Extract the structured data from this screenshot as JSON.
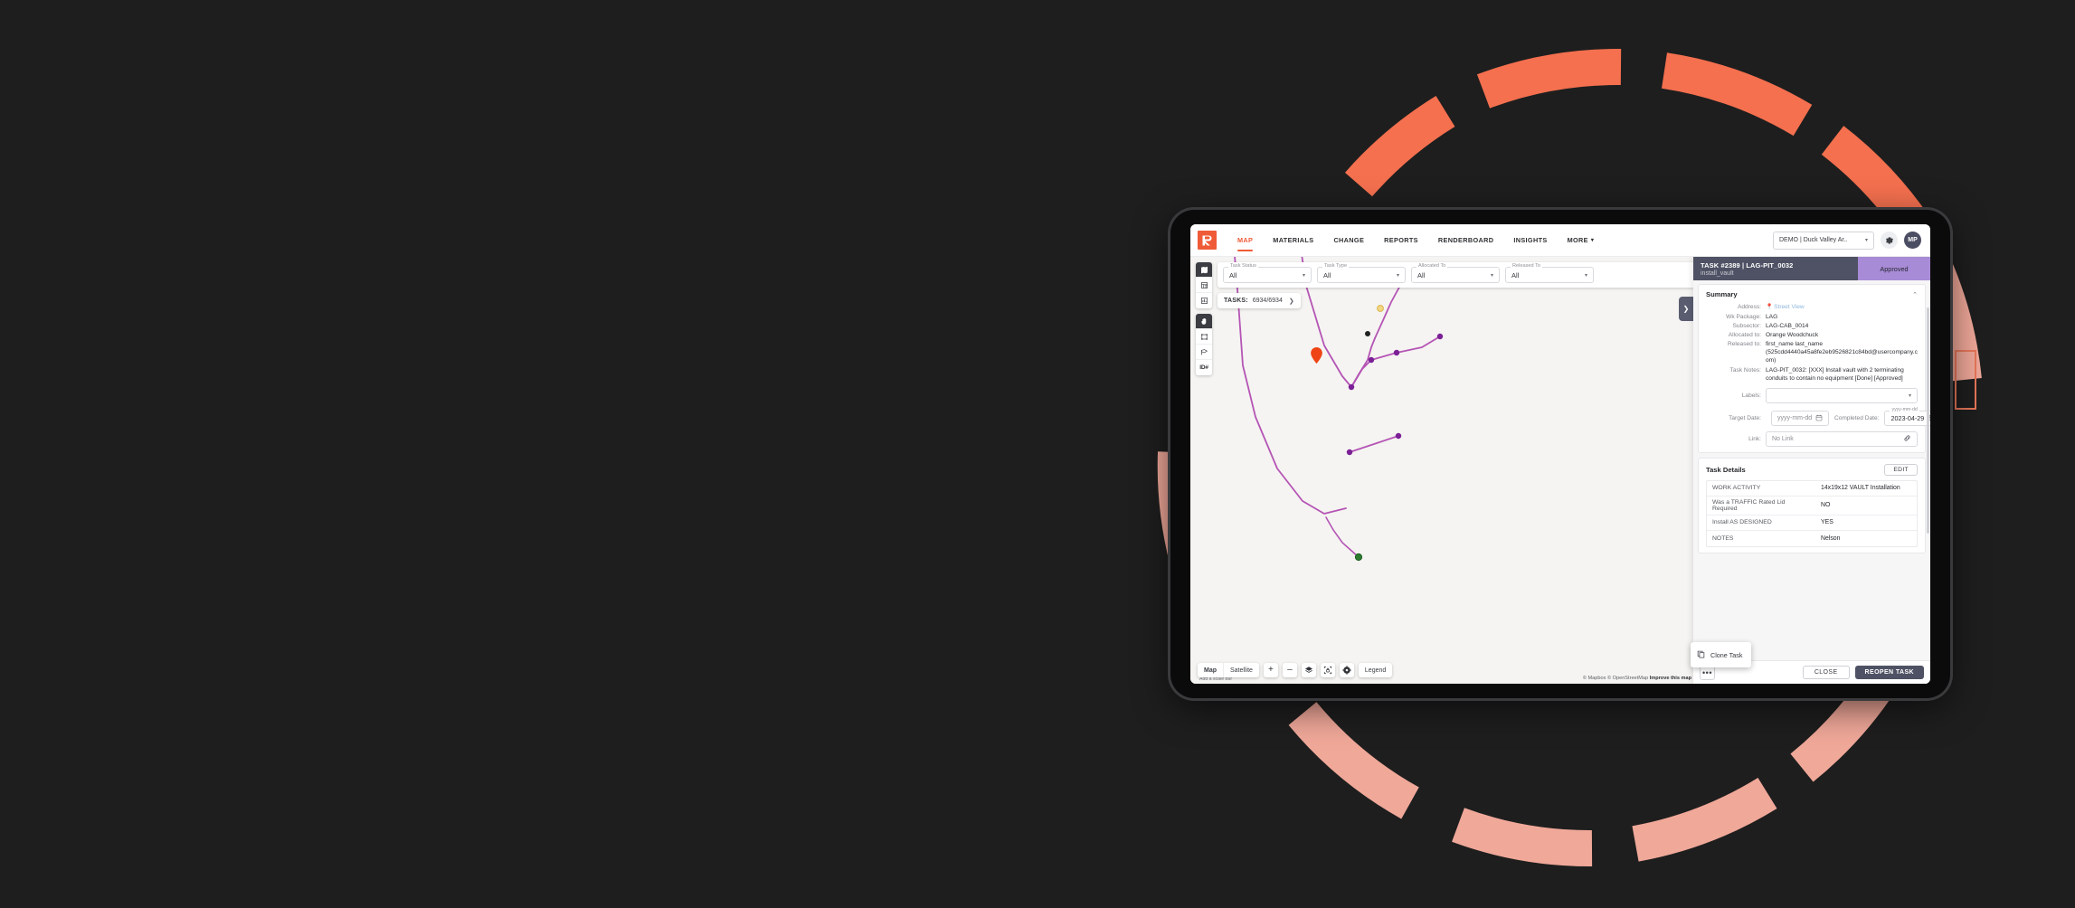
{
  "app": {
    "logo_name": "rhumbix-logo",
    "nav": [
      {
        "label": "MAP",
        "active": true
      },
      {
        "label": "MATERIALS",
        "active": false
      },
      {
        "label": "CHANGE",
        "active": false
      },
      {
        "label": "REPORTS",
        "active": false
      },
      {
        "label": "RENDERBOARD",
        "active": false
      },
      {
        "label": "INSIGHTS",
        "active": false
      },
      {
        "label": "MORE",
        "active": false,
        "caret": "▾"
      }
    ],
    "project_select": {
      "value": "DEMO | Duck Valley Ar..",
      "caret": "▾"
    },
    "settings_icon": "gear-icon",
    "avatar_initials": "MP"
  },
  "filters": [
    {
      "label": "Task Status",
      "value": "All"
    },
    {
      "label": "Task Type",
      "value": "All"
    },
    {
      "label": "Allocated To",
      "value": "All"
    },
    {
      "label": "Released To",
      "value": "All"
    }
  ],
  "tasks_pill": {
    "key": "TASKS:",
    "value": "6934/6934",
    "arrow": "❯"
  },
  "left_tools": [
    {
      "name": "map-layers-icon",
      "selected": true
    },
    {
      "name": "table-view-icon",
      "selected": false
    },
    {
      "name": "chart-view-icon",
      "selected": false
    },
    {
      "name": "pan-hand-icon",
      "selected": true
    },
    {
      "name": "rectangle-select-icon",
      "selected": false
    },
    {
      "name": "lasso-select-icon",
      "selected": false
    },
    {
      "name": "id-number-icon",
      "selected": false,
      "text": "ID#"
    }
  ],
  "map_controls": {
    "basemap": [
      {
        "label": "Map",
        "active": true
      },
      {
        "label": "Satellite",
        "active": false
      }
    ],
    "zoom_in": "+",
    "zoom_out": "–",
    "layers_icon": "layers-icon",
    "lock_icon": "lock-frame-icon",
    "settings_icon": "gear-icon",
    "legend_label": "Legend",
    "attribution": "© Mapbox © OpenStreetMap",
    "attribution_link": "Improve this map",
    "scalebar": "Add a scale bar"
  },
  "panel_toggle": "❯",
  "task_panel": {
    "title": "TASK #2389 | LAG-PIT_0032",
    "subtitle": "install_vault",
    "status": "Approved",
    "status_color": "#a78bd6",
    "summary": {
      "heading": "Summary",
      "collapse_icon": "chevron-up-icon",
      "rows": [
        {
          "key": "Address:",
          "value": "Street View",
          "is_link": true,
          "pin": true
        },
        {
          "key": "Wk Package:",
          "value": "LAG"
        },
        {
          "key": "Subsector:",
          "value": "LAG-CAB_0014"
        },
        {
          "key": "Allocated to:",
          "value": "Orange Woodchuck"
        },
        {
          "key": "Released to:",
          "value": "first_name last_name (525cdd4440a45a8fe2eb9526821c84bd@usercompany.com)"
        },
        {
          "key": "Task Notes:",
          "value": "LAG-PIT_0032: [XXX] Install vault with 2 terminating conduits to contain no equipment [Done] [Approved]"
        }
      ],
      "labels_field": {
        "key": "Labels:",
        "value": "",
        "caret": "▾"
      },
      "target_date": {
        "key": "Target Date:",
        "placeholder": "yyyy-mm-dd",
        "value": "",
        "icon": "calendar-icon"
      },
      "completed_date": {
        "key": "Completed Date:",
        "floating_label": "yyyy-mm-dd",
        "value": "2023-04-29",
        "icon": "calendar-icon"
      },
      "link_field": {
        "key": "Link:",
        "value": "No Link",
        "icon": "link-icon"
      }
    },
    "details": {
      "heading": "Task Details",
      "edit_label": "EDIT",
      "rows": [
        {
          "key": "WORK ACTIVITY",
          "value": "14x19x12 VAULT Installation"
        },
        {
          "key": "Was a TRAFFIC  Rated Lid Required",
          "value": "NO"
        },
        {
          "key": "Install AS DESIGNED",
          "value": "YES"
        },
        {
          "key": "NOTES",
          "value": "Nelson"
        }
      ]
    },
    "footer": {
      "more_label": "•••",
      "close_label": "CLOSE",
      "reopen_label": "REOPEN TASK"
    },
    "context_menu": {
      "icon": "copy-icon",
      "label": "Clone Task"
    }
  },
  "colors": {
    "brand_orange": "#ef5b37",
    "arc_top": "#f4704f",
    "arc_bottom": "#f0a899",
    "panel_dark": "#4f5264",
    "map_line": "#b554b5",
    "background": "#1e1e1e"
  }
}
